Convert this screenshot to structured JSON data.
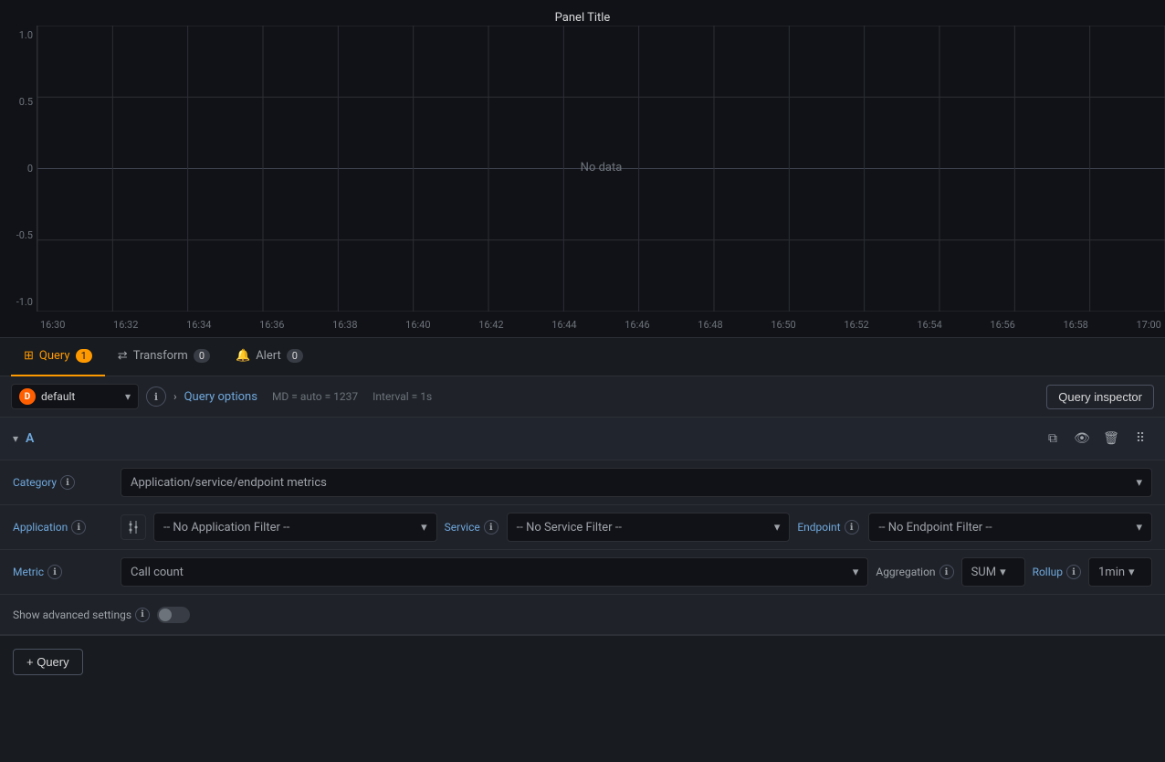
{
  "panel": {
    "title": "Panel Title"
  },
  "chart": {
    "no_data_label": "No data",
    "y_axis": [
      "1.0",
      "0.5",
      "0",
      "-0.5",
      "-1.0"
    ],
    "x_axis": [
      "16:30",
      "16:32",
      "16:34",
      "16:36",
      "16:38",
      "16:40",
      "16:42",
      "16:44",
      "16:46",
      "16:48",
      "16:50",
      "16:52",
      "16:54",
      "16:56",
      "16:58",
      "17:00"
    ]
  },
  "tabs": [
    {
      "id": "query",
      "label": "Query",
      "count": "1",
      "active": true
    },
    {
      "id": "transform",
      "label": "Transform",
      "count": "0",
      "active": false
    },
    {
      "id": "alert",
      "label": "Alert",
      "count": "0",
      "active": false
    }
  ],
  "query_bar": {
    "datasource": "default",
    "query_options_label": "Query options",
    "meta": "MD = auto = 1237",
    "interval": "Interval = 1s",
    "query_inspector_label": "Query inspector"
  },
  "query_a": {
    "name": "A",
    "category_label": "Category",
    "category_value": "Application/service/endpoint metrics",
    "application_label": "Application",
    "application_placeholder": "-- No Application Filter --",
    "service_label": "Service",
    "service_placeholder": "-- No Service Filter --",
    "endpoint_label": "Endpoint",
    "endpoint_placeholder": "-- No Endpoint Filter --",
    "metric_label": "Metric",
    "metric_value": "Call count",
    "aggregation_label": "Aggregation",
    "sum_value": "SUM",
    "rollup_label": "Rollup",
    "rollup_value": "1min",
    "advanced_label": "Show advanced settings"
  },
  "add_query": {
    "label": "+ Query"
  }
}
